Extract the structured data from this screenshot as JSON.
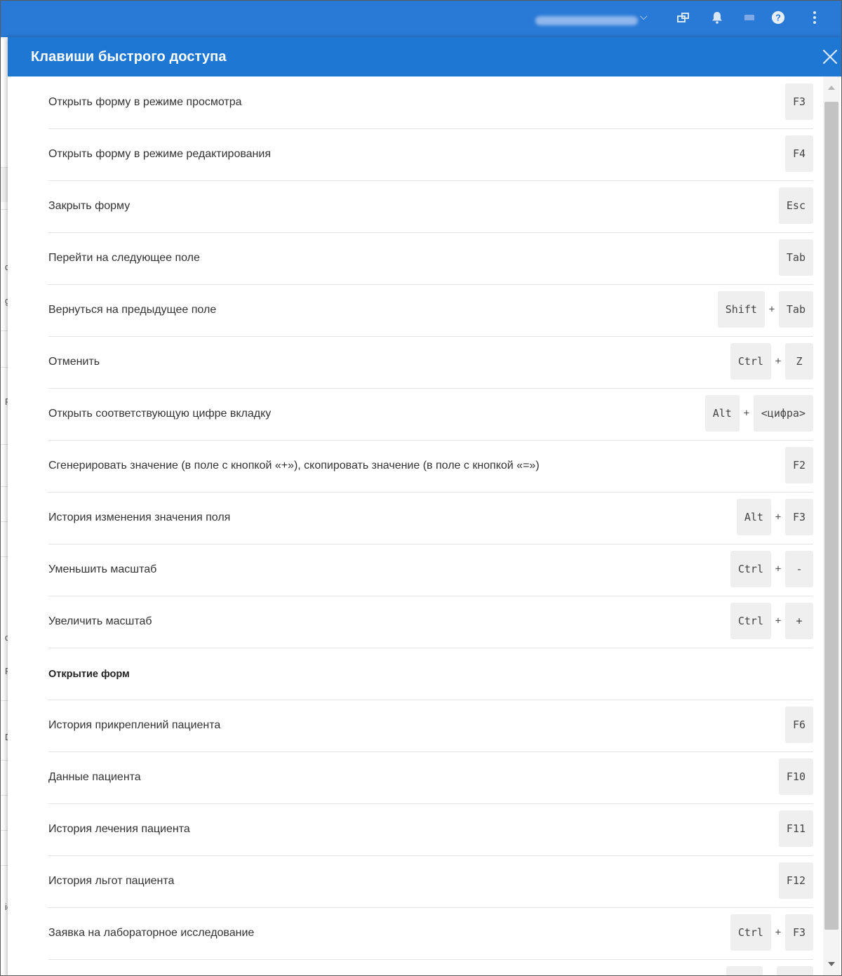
{
  "appbar": {
    "user_chevron": "⌵",
    "icons": [
      "user-name-blurred",
      "app-switch-icon",
      "bell-icon",
      "message-icon",
      "help-icon",
      "more-vert-icon"
    ],
    "bg_color": "#2979d6"
  },
  "modal": {
    "title": "Клавиши быстрого доступа",
    "close_icon": "close-icon",
    "header_color": "#1f77d4"
  },
  "shortcuts": [
    {
      "description": "Открыть форму в режиме просмотра",
      "keys": [
        "F3"
      ]
    },
    {
      "description": "Открыть форму в режиме редактирования",
      "keys": [
        "F4"
      ]
    },
    {
      "description": "Закрыть форму",
      "keys": [
        "Esc"
      ]
    },
    {
      "description": "Перейти на следующее поле",
      "keys": [
        "Tab"
      ]
    },
    {
      "description": "Вернуться на предыдущее поле",
      "keys": [
        "Shift",
        "Tab"
      ]
    },
    {
      "description": "Отменить",
      "keys": [
        "Ctrl",
        "Z"
      ]
    },
    {
      "description": "Открыть соответствующую цифре вкладку",
      "keys": [
        "Alt",
        "<цифра>"
      ]
    },
    {
      "description": "Сгенерировать значение (в поле с кнопкой «+»), скопировать значение (в поле с кнопкой «=»)",
      "keys": [
        "F2"
      ]
    },
    {
      "description": "История изменения значения поля",
      "keys": [
        "Alt",
        "F3"
      ]
    },
    {
      "description": "Уменьшить масштаб",
      "keys": [
        "Ctrl",
        "-"
      ]
    },
    {
      "description": "Увеличить масштаб",
      "keys": [
        "Ctrl",
        "+"
      ]
    },
    {
      "description": "Открытие форм",
      "section": true,
      "keys": []
    },
    {
      "description": "История прикреплений пациента",
      "keys": [
        "F6"
      ]
    },
    {
      "description": "Данные пациента",
      "keys": [
        "F10"
      ]
    },
    {
      "description": "История лечения пациента",
      "keys": [
        "F11"
      ]
    },
    {
      "description": "История льгот пациента",
      "keys": [
        "F12"
      ]
    },
    {
      "description": "Заявка на лабораторное исследование",
      "keys": [
        "Ctrl",
        "F3"
      ]
    },
    {
      "description": "",
      "keys": [
        "",
        ""
      ]
    }
  ],
  "key_separator": "+",
  "backdrop_fragments": [
    "di",
    "gl",
    "Re",
    "dr",
    "P",
    "D",
    "ic"
  ]
}
